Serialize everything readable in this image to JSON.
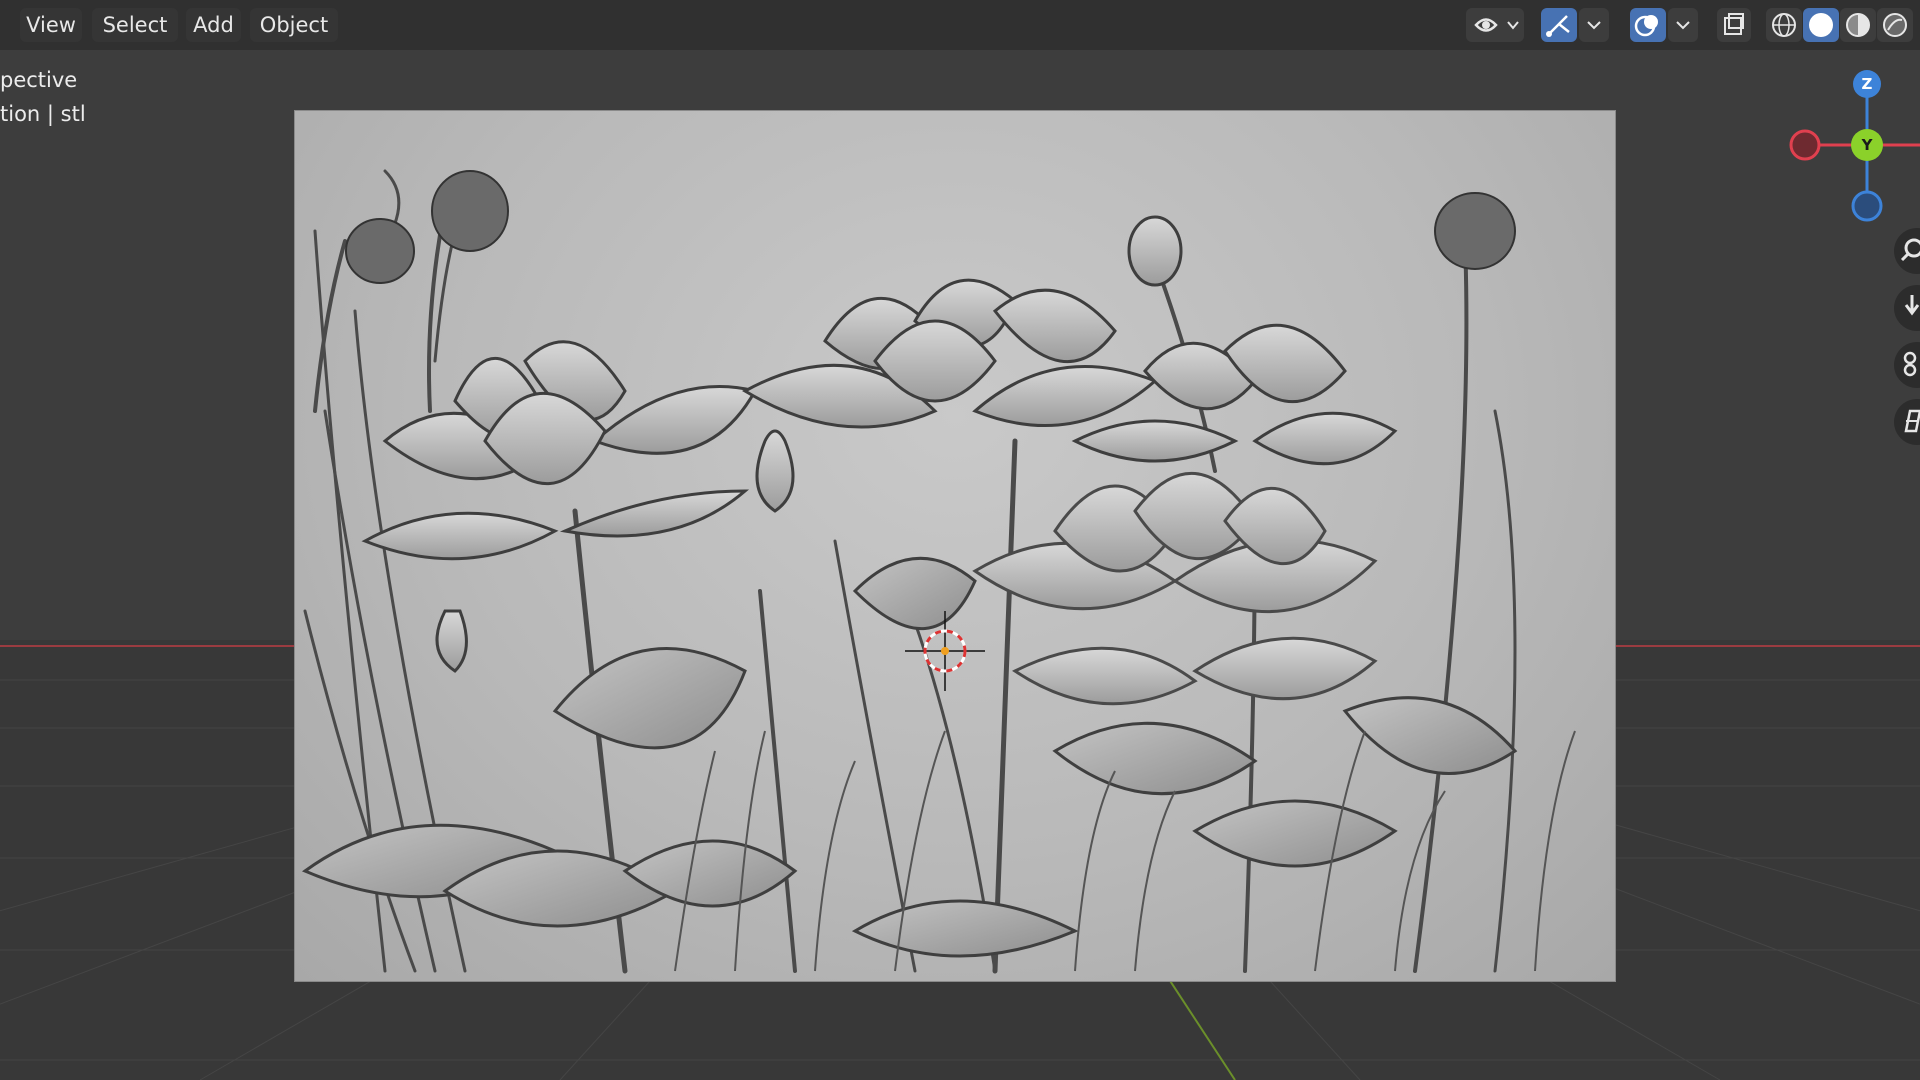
{
  "menu": {
    "view": "View",
    "select": "Select",
    "add": "Add",
    "object": "Object"
  },
  "overlay": {
    "line1": "pective",
    "line2": "tion | stl"
  },
  "gizmo": {
    "z_label": "Z",
    "y_label": "Y",
    "x_color": "#e0404f",
    "y_color": "#8bd12a",
    "z_color": "#3d83d9"
  },
  "header_icons": [
    "visibility-icon",
    "gizmo-icon",
    "overlay-icon",
    "xray-icon",
    "wireframe-shading-icon",
    "solid-shading-icon",
    "material-shading-icon",
    "rendered-shading-icon"
  ],
  "nav_icons": [
    "zoom-icon",
    "pan-icon",
    "camera-icon",
    "orthographic-icon"
  ],
  "colors": {
    "viewport_bg": "#3d3d3d",
    "header_bg": "#303030",
    "active_button": "#4772b3",
    "x_axis_line": "#9a3b40",
    "y_axis_line": "#6b8f2a"
  }
}
